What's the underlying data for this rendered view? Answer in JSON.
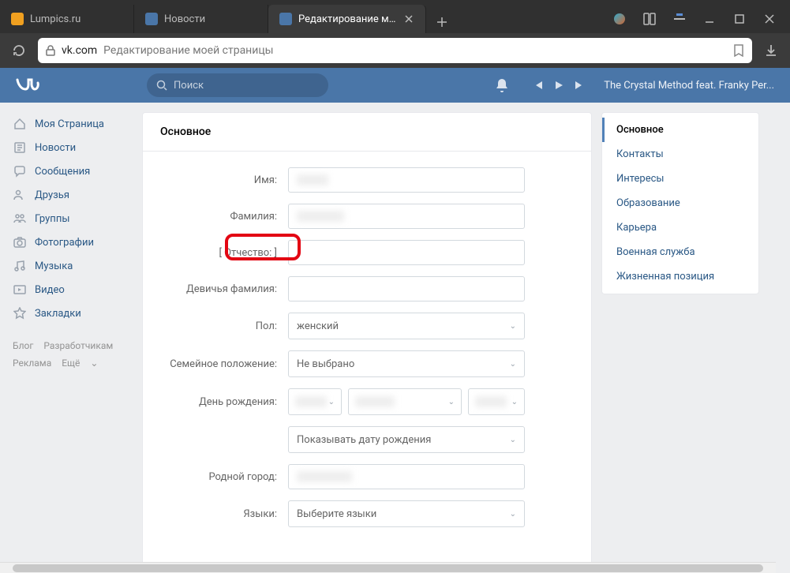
{
  "tabs": [
    {
      "title": "Lumpics.ru",
      "favicon_color": "#f0a020"
    },
    {
      "title": "Новости",
      "favicon_color": "#4a76a8"
    },
    {
      "title": "Редактирование моей…",
      "favicon_color": "#4a76a8"
    }
  ],
  "address": {
    "domain": "vk.com",
    "rest": "Редактирование моей страницы"
  },
  "vk_header": {
    "search_placeholder": "Поиск",
    "now_playing": "The Crystal Method feat. Franky Per..."
  },
  "left_nav": [
    {
      "icon": "home",
      "label": "Моя Страница"
    },
    {
      "icon": "news",
      "label": "Новости"
    },
    {
      "icon": "msg",
      "label": "Сообщения"
    },
    {
      "icon": "friends",
      "label": "Друзья"
    },
    {
      "icon": "groups",
      "label": "Группы"
    },
    {
      "icon": "photos",
      "label": "Фотографии"
    },
    {
      "icon": "music",
      "label": "Музыка"
    },
    {
      "icon": "video",
      "label": "Видео"
    },
    {
      "icon": "bookmarks",
      "label": "Закладки"
    }
  ],
  "nav_footer": {
    "blog": "Блог",
    "dev": "Разработчикам",
    "ads": "Реклама",
    "more": "Ещё"
  },
  "form": {
    "title": "Основное",
    "labels": {
      "first_name": "Имя:",
      "last_name": "Фамилия:",
      "patronymic_bracketed": "[ Отчество: ]",
      "maiden_name": "Девичья фамилия:",
      "gender": "Пол:",
      "marital": "Семейное положение:",
      "birthday": "День рождения:",
      "hometown": "Родной город:",
      "languages": "Языки:"
    },
    "values": {
      "gender": "женский",
      "marital": "Не выбрано",
      "bday_visibility": "Показывать дату рождения",
      "languages": "Выберите языки"
    }
  },
  "right_menu": [
    "Основное",
    "Контакты",
    "Интересы",
    "Образование",
    "Карьера",
    "Военная служба",
    "Жизненная позиция"
  ]
}
